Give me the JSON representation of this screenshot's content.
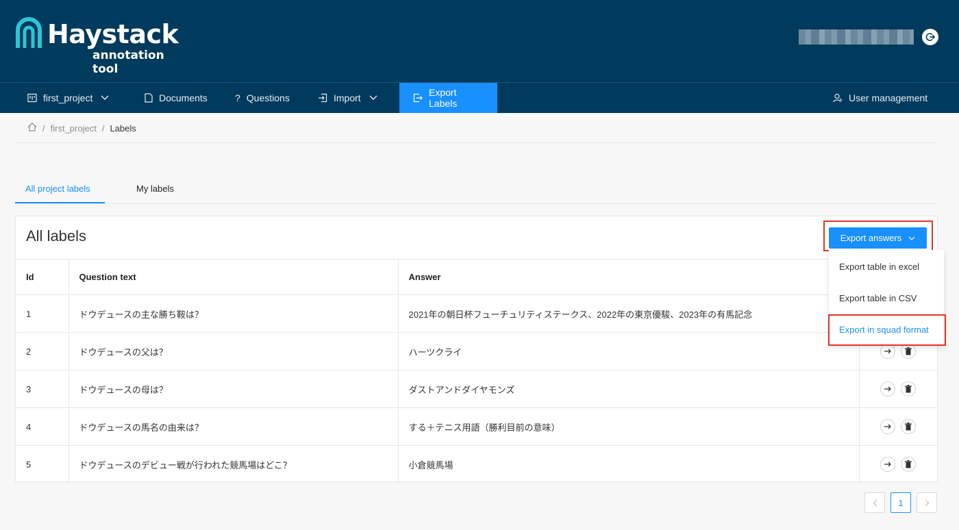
{
  "brand": {
    "title": "Haystack",
    "subtitle": "annotation tool"
  },
  "nav": {
    "project": "first_project",
    "documents": "Documents",
    "questions": "Questions",
    "import": "Import",
    "export_labels": "Export Labels",
    "user_management": "User management"
  },
  "breadcrumb": {
    "project": "first_project",
    "current": "Labels"
  },
  "tabs": {
    "all": "All project labels",
    "mine": "My labels"
  },
  "card": {
    "title": "All labels",
    "export_button": "Export answers"
  },
  "table": {
    "headers": {
      "id": "Id",
      "question": "Question text",
      "answer": "Answer"
    },
    "rows": [
      {
        "id": "1",
        "question": "ドウデュースの主な勝ち鞍は？",
        "answer": "2021年の朝日杯フューチュリティステークス、2022年の東京優駿、2023年の有馬記念"
      },
      {
        "id": "2",
        "question": "ドウデュースの父は？",
        "answer": "ハーツクライ"
      },
      {
        "id": "3",
        "question": "ドウデュースの母は？",
        "answer": "ダストアンドダイヤモンズ"
      },
      {
        "id": "4",
        "question": "ドウデュースの馬名の由来は？",
        "answer": "する＋テニス用語（勝利目前の意味）"
      },
      {
        "id": "5",
        "question": "ドウデュースのデビュー戦が行われた競馬場はどこ？",
        "answer": "小倉競馬場"
      }
    ]
  },
  "dropdown": {
    "excel": "Export table in excel",
    "csv": "Export table in CSV",
    "squad": "Export in squad format"
  },
  "pagination": {
    "current": "1"
  },
  "colors": {
    "header_bg": "#003a5c",
    "accent": "#1890ff",
    "highlight": "#e53323"
  }
}
